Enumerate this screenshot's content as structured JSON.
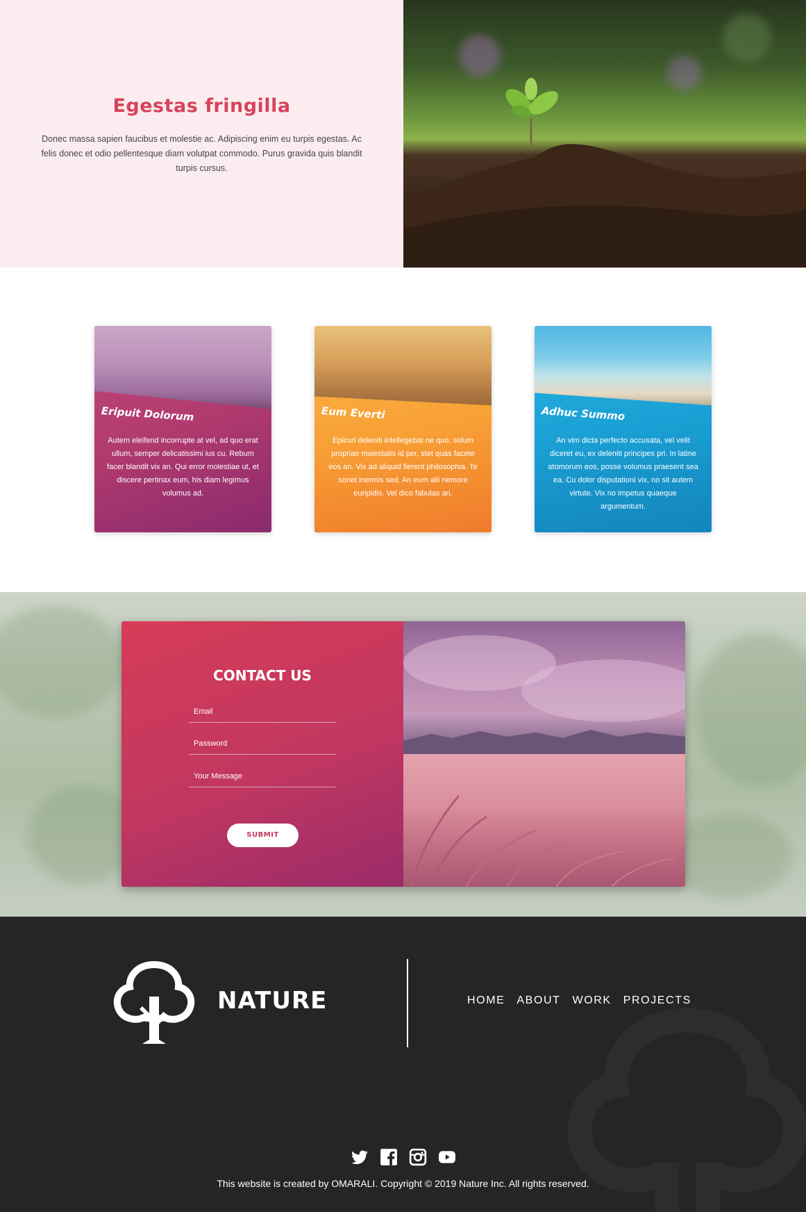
{
  "hero": {
    "title": "Egestas fringilla",
    "text": "Donec massa sapien faucibus et molestie ac. Adipiscing enim eu turpis egestas. Ac felis donec et odio pellentesque diam volutpat commodo. Purus gravida quis blandit turpis cursus.",
    "image": "seedling-in-soil-photo"
  },
  "cards": [
    {
      "heading": "Eripuit Dolorum",
      "text": "Autem eleifend incorrupte at vel, ad quo erat ullum, semper delicatissimi ius cu. Rebum facer blandit vix an. Qui error molestiae ut, et discere pertinax eum, his diam legimus volumus ad.",
      "image": "car-window-hat-photo",
      "color": "#b03a6e"
    },
    {
      "heading": "Eum Everti",
      "text": "Epicuri deleniti intellegebat ne quo, solum propriae maiestatis id per, stet quas facete eos an. Vix ad aliquid fierent philosophia. Te sonet inermis sed. An eum alii nemore euripidis. Vel dico fabulas an.",
      "image": "hiker-on-hillside-photo",
      "color": "#f8a135"
    },
    {
      "heading": "Adhuc Summo",
      "text": "An vim dicta perfecto accusata, vel velit diceret eu, ex deleniti principes pri. In latine atomorum eos, posse volumus praesent sea ea. Cu dolor disputationi vix, no sit autem virtute. Vix no impetus quaeque argumentum.",
      "image": "tropical-beach-photo",
      "color": "#1aa0d4"
    }
  ],
  "contact": {
    "title": "CONTACT US",
    "email_placeholder": "Email",
    "password_placeholder": "Password",
    "message_placeholder": "Your Message",
    "submit_label": "SUBMIT",
    "image_top": "clouds-over-mountains-photo",
    "image_bottom": "wild-grass-photo"
  },
  "footer": {
    "logo_text": "NATURE",
    "logo_icon": "tree-icon",
    "nav": [
      "HOME",
      "ABOUT",
      "WORK",
      "PROJECTS"
    ],
    "socials": [
      "twitter-icon",
      "facebook-icon",
      "instagram-icon",
      "youtube-icon"
    ],
    "copyright": "This website is created by OMARALI. Copyright © 2019 Nature Inc. All rights reserved."
  }
}
